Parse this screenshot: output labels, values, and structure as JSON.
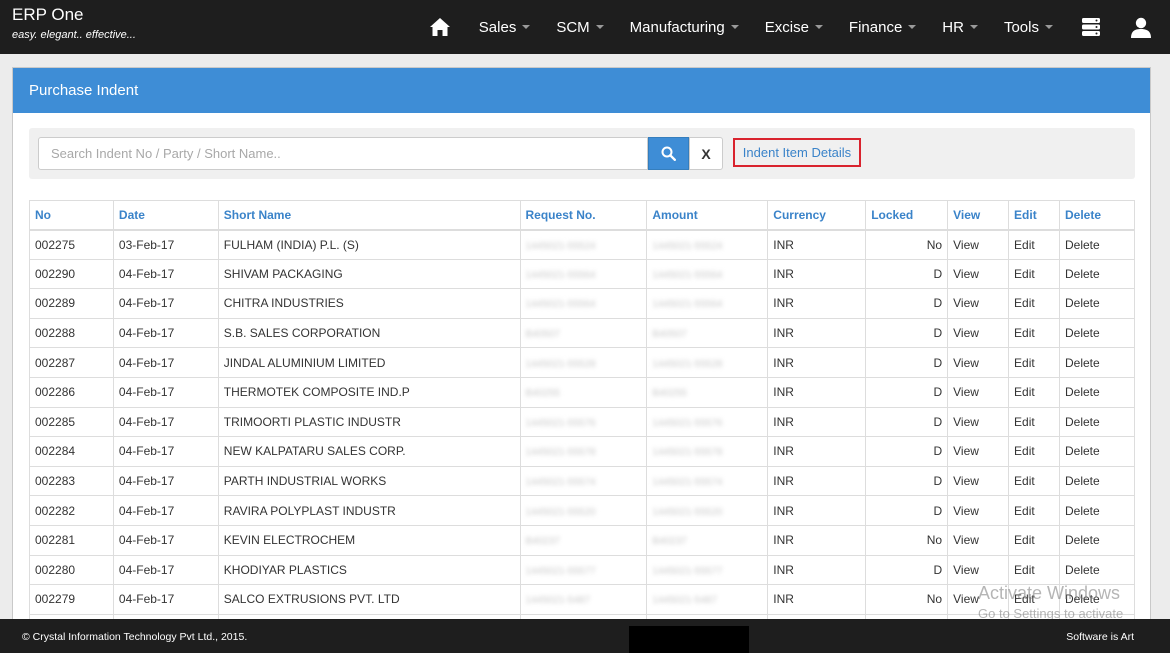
{
  "app": {
    "title": "ERP One",
    "tagline": "easy. elegant.. effective..."
  },
  "nav": {
    "items": [
      {
        "id": "sales",
        "label": "Sales"
      },
      {
        "id": "scm",
        "label": "SCM"
      },
      {
        "id": "manufacturing",
        "label": "Manufacturing"
      },
      {
        "id": "excise",
        "label": "Excise"
      },
      {
        "id": "finance",
        "label": "Finance"
      },
      {
        "id": "hr",
        "label": "HR"
      },
      {
        "id": "tools",
        "label": "Tools"
      }
    ],
    "icons": {
      "home": "home-icon",
      "database": "database-icon",
      "user": "user-icon"
    }
  },
  "panel": {
    "title": "Purchase Indent"
  },
  "search": {
    "placeholder": "Search Indent No / Party / Short Name..",
    "value": "",
    "clear_label": "X",
    "indent_item_link": "Indent Item Details"
  },
  "table": {
    "headers": {
      "no": "No",
      "date": "Date",
      "short_name": "Short Name",
      "request_no": "Request No.",
      "amount": "Amount",
      "currency": "Currency",
      "locked": "Locked",
      "view": "View",
      "edit": "Edit",
      "delete": "Delete"
    },
    "rows": [
      {
        "no": "002275",
        "date": "03-Feb-17",
        "short_name": "FULHAM (INDIA) P.L. (S)",
        "request_no": "1445021-55524",
        "amount": "1445021-55524",
        "currency": "INR",
        "locked": "No",
        "view": "View",
        "edit": "Edit",
        "delete": "Delete"
      },
      {
        "no": "002290",
        "date": "04-Feb-17",
        "short_name": "SHIVAM PACKAGING",
        "request_no": "1445021-55564",
        "amount": "1445021-55564",
        "currency": "INR",
        "locked": "D",
        "view": "View",
        "edit": "Edit",
        "delete": "Delete"
      },
      {
        "no": "002289",
        "date": "04-Feb-17",
        "short_name": "CHITRA INDUSTRIES",
        "request_no": "1445021-55564",
        "amount": "1445021-55564",
        "currency": "INR",
        "locked": "D",
        "view": "View",
        "edit": "Edit",
        "delete": "Delete"
      },
      {
        "no": "002288",
        "date": "04-Feb-17",
        "short_name": "S.B. SALES CORPORATION",
        "request_no": "B40507",
        "amount": "B40507",
        "currency": "INR",
        "locked": "D",
        "view": "View",
        "edit": "Edit",
        "delete": "Delete"
      },
      {
        "no": "002287",
        "date": "04-Feb-17",
        "short_name": "JINDAL ALUMINIUM LIMITED",
        "request_no": "1445021-55528",
        "amount": "1445021-55528",
        "currency": "INR",
        "locked": "D",
        "view": "View",
        "edit": "Edit",
        "delete": "Delete"
      },
      {
        "no": "002286",
        "date": "04-Feb-17",
        "short_name": "THERMOTEK COMPOSITE IND.P",
        "request_no": "B40255",
        "amount": "B40255",
        "currency": "INR",
        "locked": "D",
        "view": "View",
        "edit": "Edit",
        "delete": "Delete"
      },
      {
        "no": "002285",
        "date": "04-Feb-17",
        "short_name": "TRIMOORTI PLASTIC INDUSTR",
        "request_no": "1445021-55576",
        "amount": "1445021-55576",
        "currency": "INR",
        "locked": "D",
        "view": "View",
        "edit": "Edit",
        "delete": "Delete"
      },
      {
        "no": "002284",
        "date": "04-Feb-17",
        "short_name": "NEW KALPATARU SALES CORP.",
        "request_no": "1445021-55578",
        "amount": "1445021-55578",
        "currency": "INR",
        "locked": "D",
        "view": "View",
        "edit": "Edit",
        "delete": "Delete"
      },
      {
        "no": "002283",
        "date": "04-Feb-17",
        "short_name": "PARTH INDUSTRIAL WORKS",
        "request_no": "1445021-55574",
        "amount": "1445021-55574",
        "currency": "INR",
        "locked": "D",
        "view": "View",
        "edit": "Edit",
        "delete": "Delete"
      },
      {
        "no": "002282",
        "date": "04-Feb-17",
        "short_name": "RAVIRA POLYPLAST INDUSTR",
        "request_no": "1445021-55520",
        "amount": "1445021-55520",
        "currency": "INR",
        "locked": "D",
        "view": "View",
        "edit": "Edit",
        "delete": "Delete"
      },
      {
        "no": "002281",
        "date": "04-Feb-17",
        "short_name": "KEVIN ELECTROCHEM",
        "request_no": "B40237",
        "amount": "B40237",
        "currency": "INR",
        "locked": "No",
        "view": "View",
        "edit": "Edit",
        "delete": "Delete"
      },
      {
        "no": "002280",
        "date": "04-Feb-17",
        "short_name": "KHODIYAR PLASTICS",
        "request_no": "1445021-55577",
        "amount": "1445021-55577",
        "currency": "INR",
        "locked": "D",
        "view": "View",
        "edit": "Edit",
        "delete": "Delete"
      },
      {
        "no": "002279",
        "date": "04-Feb-17",
        "short_name": "SALCO EXTRUSIONS PVT. LTD",
        "request_no": "1445021-5487",
        "amount": "1445021-5487",
        "currency": "INR",
        "locked": "No",
        "view": "View",
        "edit": "Edit",
        "delete": "Delete"
      },
      {
        "no": "",
        "date": "",
        "short_name": "",
        "request_no": "",
        "amount": "",
        "currency": "",
        "locked": "",
        "view": "",
        "edit": "",
        "delete": ""
      }
    ]
  },
  "footer": {
    "copyright": "© Crystal Information Technology Pvt Ltd., 2015.",
    "right": "Software is Art"
  },
  "watermark": {
    "line1": "Activate Windows",
    "line2": "Go to Settings to activate Windows."
  },
  "colors": {
    "accent": "#3e8dd6",
    "link": "#3a83c9",
    "navbar": "#1e1e1e",
    "highlight": "#d9232e"
  }
}
